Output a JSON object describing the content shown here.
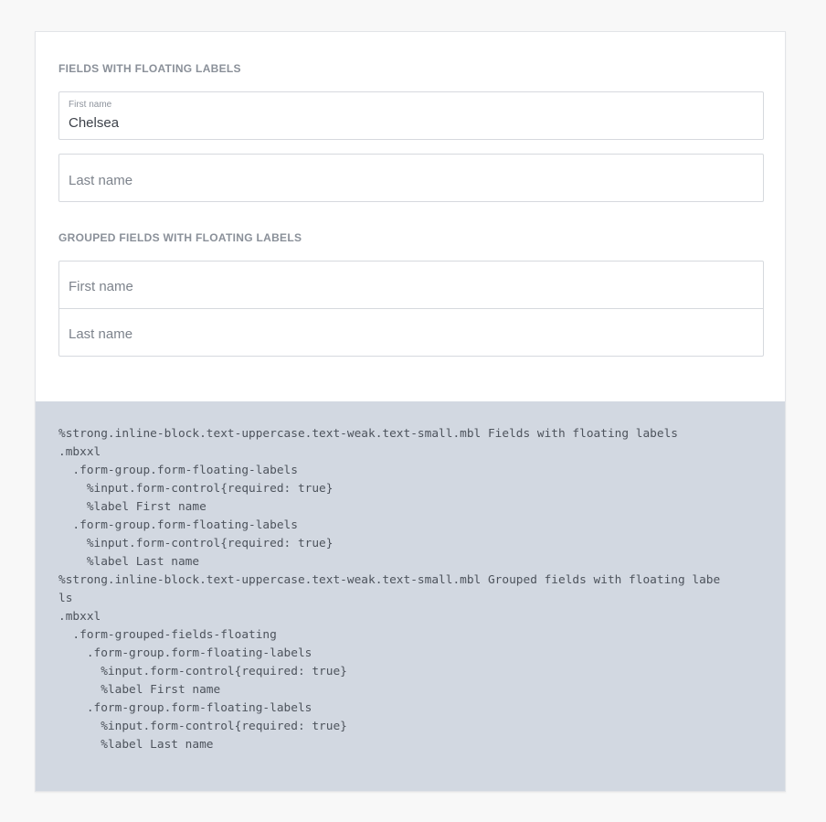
{
  "section1": {
    "title": "Fields with floating labels",
    "first_name": {
      "label": "First name",
      "value": "Chelsea"
    },
    "last_name": {
      "placeholder": "Last name"
    }
  },
  "section2": {
    "title": "Grouped fields with floating labels",
    "first_name": {
      "placeholder": "First name"
    },
    "last_name": {
      "placeholder": "Last name"
    }
  },
  "code_lines": [
    "%strong.inline-block.text-uppercase.text-weak.text-small.mbl Fields with floating labels",
    ".mbxxl",
    "  .form-group.form-floating-labels",
    "    %input.form-control{required: true}",
    "    %label First name",
    "  .form-group.form-floating-labels",
    "    %input.form-control{required: true}",
    "    %label Last name",
    "%strong.inline-block.text-uppercase.text-weak.text-small.mbl Grouped fields with floating labe",
    "ls",
    ".mbxxl",
    "  .form-grouped-fields-floating",
    "    .form-group.form-floating-labels",
    "      %input.form-control{required: true}",
    "      %label First name",
    "    .form-group.form-floating-labels",
    "      %input.form-control{required: true}",
    "      %label Last name"
  ]
}
